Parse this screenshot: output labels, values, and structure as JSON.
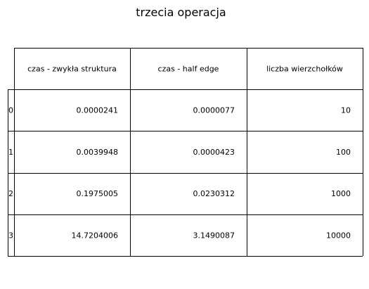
{
  "title": "trzecia operacja",
  "chart_data": {
    "type": "table",
    "title": "trzecia operacja",
    "columns": [
      "czas - zwykła struktura",
      "czas - half edge",
      "liczba wierzchołków"
    ],
    "row_labels": [
      "0",
      "1",
      "2",
      "3"
    ],
    "rows": [
      [
        "0.0000241",
        "0.0000077",
        "10"
      ],
      [
        "0.0039948",
        "0.0000423",
        "100"
      ],
      [
        "0.1975005",
        "0.0230312",
        "1000"
      ],
      [
        "14.7204006",
        "3.1490087",
        "10000"
      ]
    ]
  },
  "colors": {
    "background": "#ffffff",
    "lines": "#000000",
    "text": "#000000"
  }
}
